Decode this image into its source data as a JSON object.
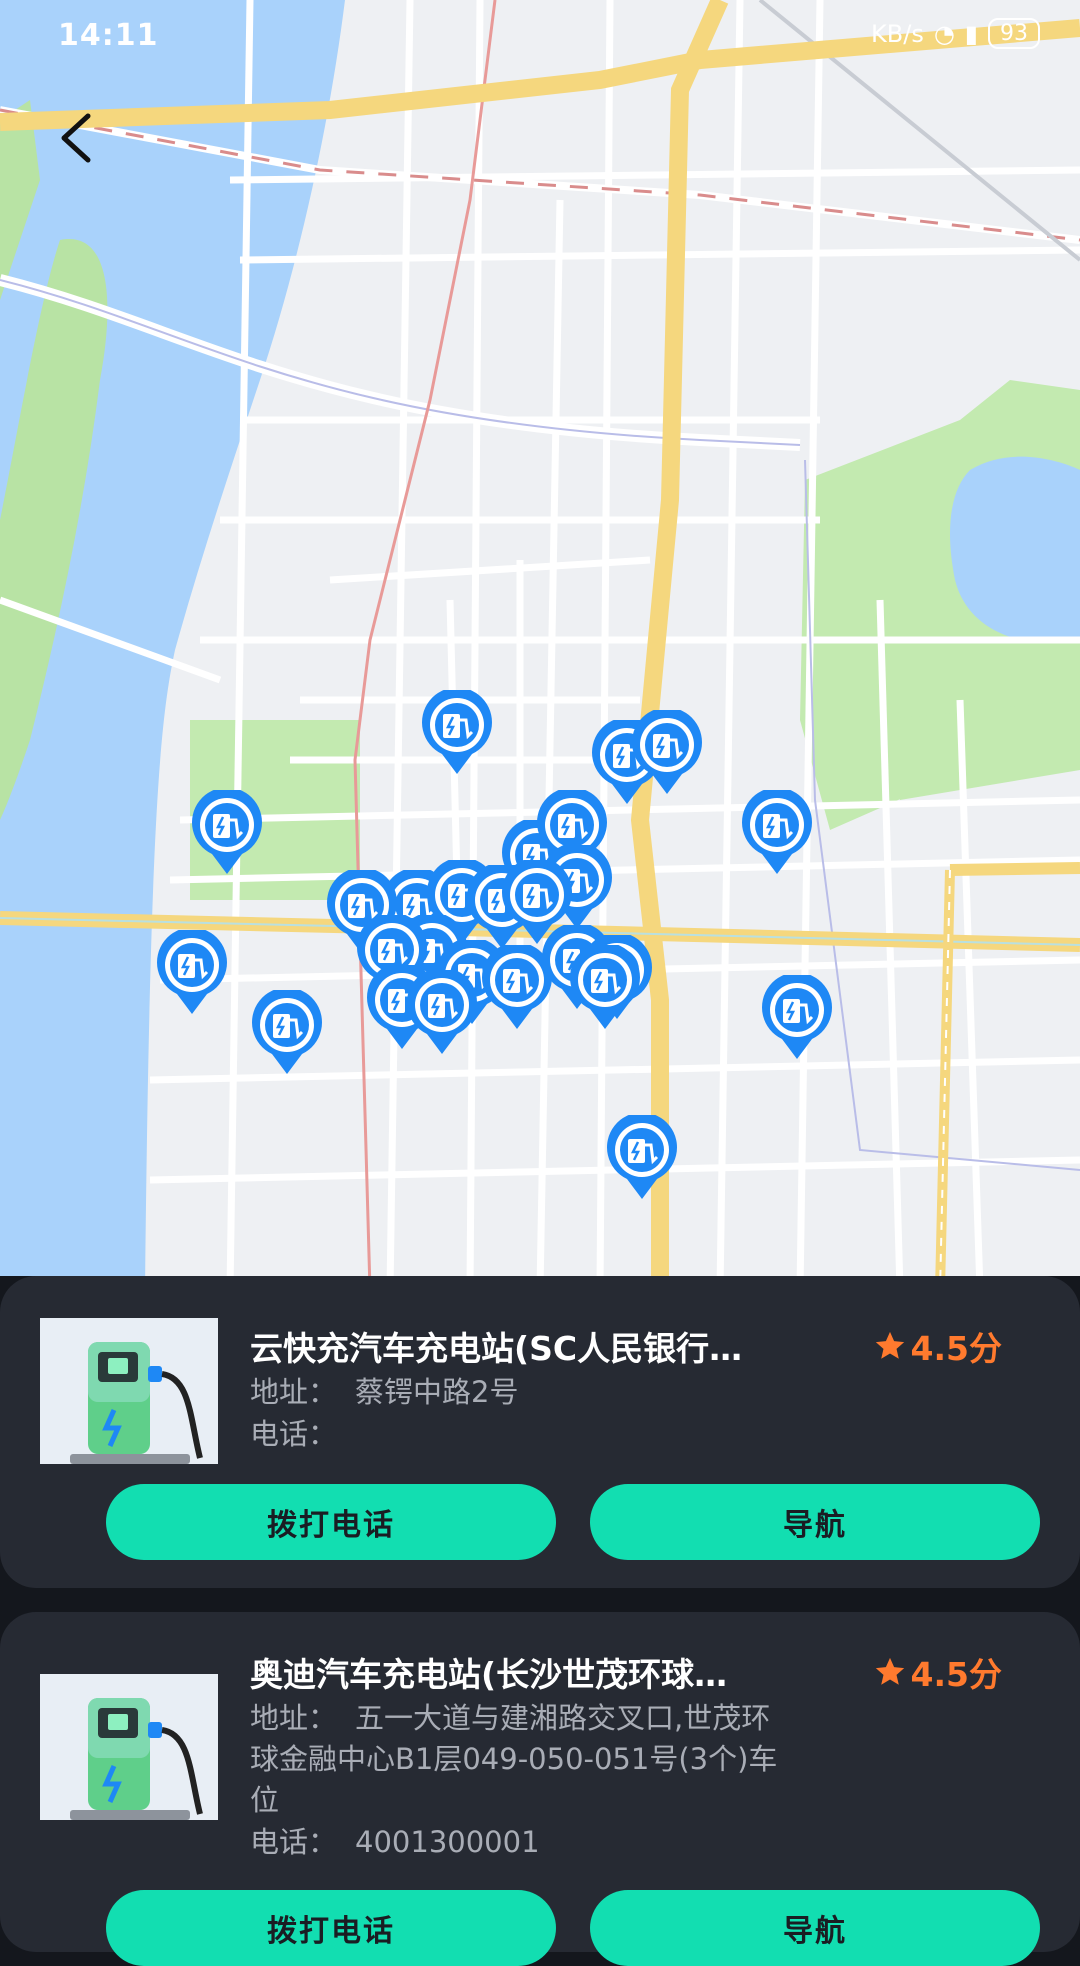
{
  "status_bar": {
    "time": "14:11",
    "signal_text": "KB/s",
    "battery": "93"
  },
  "map": {
    "marker_icon": "charging-station-pin-icon",
    "marker_color": "#1e88f5"
  },
  "stations": [
    {
      "name": "云快充汽车充电站(SC人民银行…",
      "rating": "4.5分",
      "address_label": "地址：",
      "address": "蔡锷中路2号",
      "phone_label": "电话：",
      "phone": "",
      "call_label": "拨打电话",
      "nav_label": "导航"
    },
    {
      "name": "奥迪汽车充电站(长沙世茂环球…",
      "rating": "4.5分",
      "address_label": "地址：",
      "address_line1": "五一大道与建湘路交叉口,世茂环",
      "address_line2": "球金融中心B1层049-050-051号(3个)车",
      "address_line3": "位",
      "phone_label": "电话：",
      "phone": "4001300001",
      "call_label": "拨打电话",
      "nav_label": "导航"
    }
  ],
  "colors": {
    "accent": "#12deb1",
    "rating": "#ff7a2e",
    "card_bg": "#262a33"
  }
}
